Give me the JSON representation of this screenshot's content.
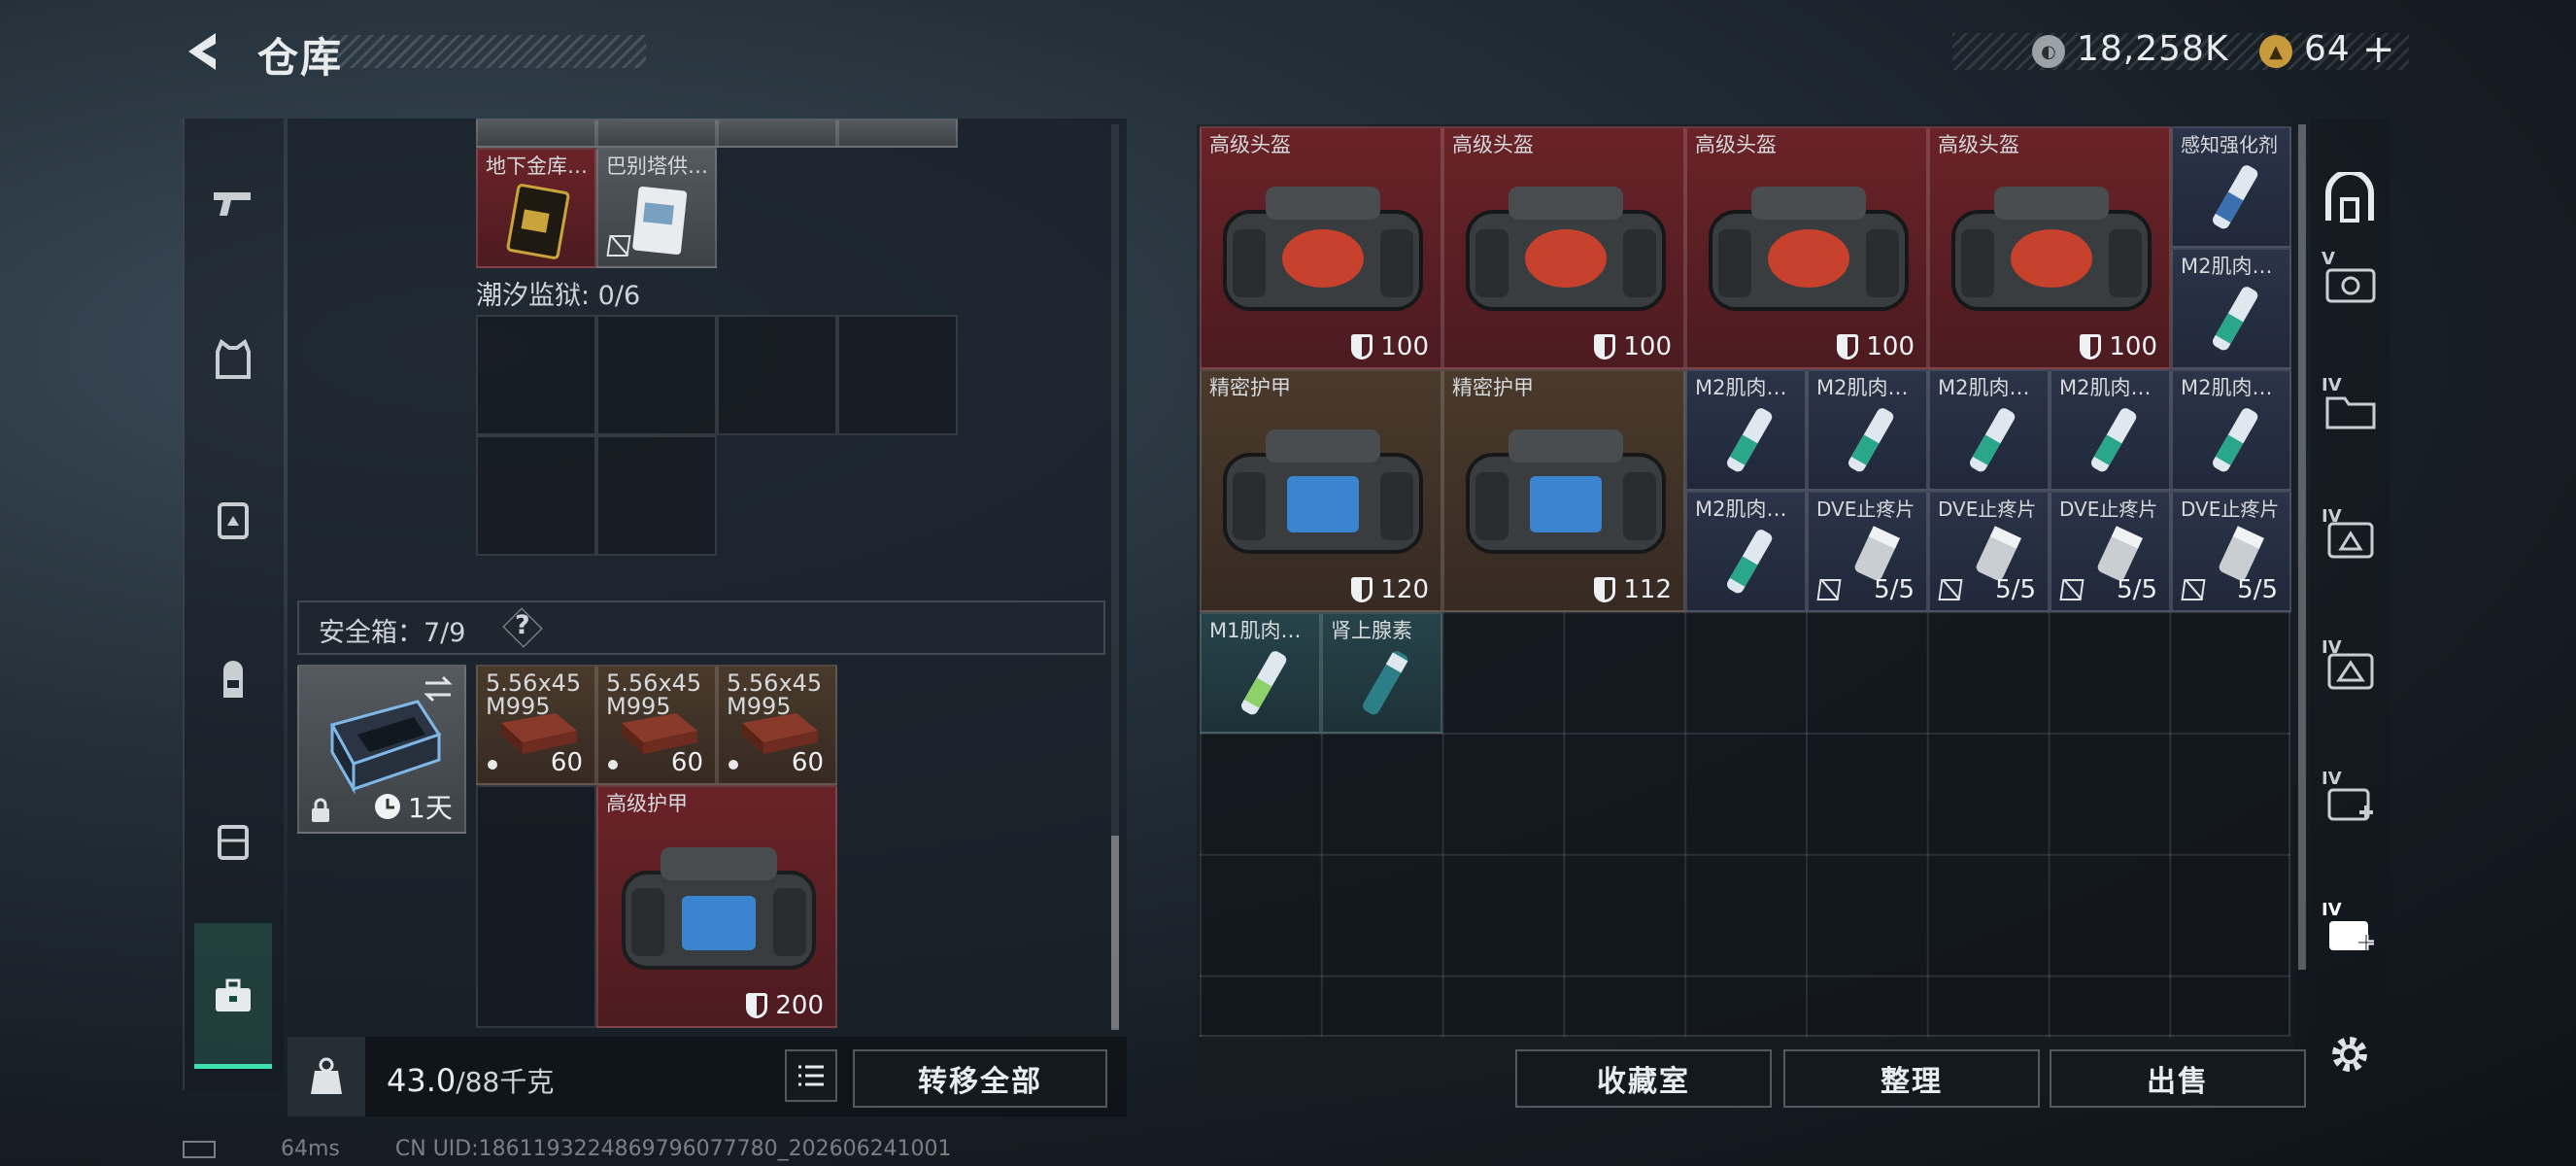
{
  "header": {
    "title": "仓库",
    "currency1": "18,258K",
    "currency2": "64",
    "plus": "+"
  },
  "left": {
    "top_items": [
      {
        "name": "地下金库…"
      },
      {
        "name": "巴别塔供…"
      }
    ],
    "prison": {
      "label": "潮汐监狱: 0/6"
    },
    "safe": {
      "label": "安全箱：7/9",
      "help": "?",
      "time": "1天"
    },
    "ammo": [
      {
        "name": "5.56x45",
        "sub": "M995",
        "qty": "60"
      },
      {
        "name": "5.56x45",
        "sub": "M995",
        "qty": "60"
      },
      {
        "name": "5.56x45",
        "sub": "M995",
        "qty": "60"
      }
    ],
    "armor": {
      "name": "高级护甲",
      "val": "200"
    },
    "weight": {
      "current": "43.0",
      "max": "/88千克"
    },
    "transfer_all": "转移全部"
  },
  "right": {
    "items": [
      {
        "name": "高级头盔",
        "val": "100"
      },
      {
        "name": "高级头盔",
        "val": "100"
      },
      {
        "name": "高级头盔",
        "val": "100"
      },
      {
        "name": "高级头盔",
        "val": "100"
      },
      {
        "name": "感知强化剂"
      },
      {
        "name": "M2肌肉…"
      },
      {
        "name": "精密护甲",
        "val": "120"
      },
      {
        "name": "精密护甲",
        "val": "112"
      },
      {
        "name": "M2肌肉…"
      },
      {
        "name": "M2肌肉…"
      },
      {
        "name": "M2肌肉…"
      },
      {
        "name": "M2肌肉…"
      },
      {
        "name": "M2肌肉…"
      },
      {
        "name": "M2肌肉…"
      },
      {
        "name": "DVE止疼片",
        "val": "5/5"
      },
      {
        "name": "DVE止疼片",
        "val": "5/5"
      },
      {
        "name": "DVE止疼片",
        "val": "5/5"
      },
      {
        "name": "DVE止疼片",
        "val": "5/5"
      },
      {
        "name": "M1肌肉…"
      },
      {
        "name": "肾上腺素"
      }
    ],
    "buttons": {
      "collection": "收藏室",
      "sort": "整理",
      "sell": "出售"
    },
    "side_tabs": [
      "V",
      "IV",
      "IV",
      "IV",
      "IV",
      "IV"
    ]
  },
  "footer": {
    "ping": "64ms",
    "uid": "CN UID:1861193224869796077780_202606241001"
  }
}
